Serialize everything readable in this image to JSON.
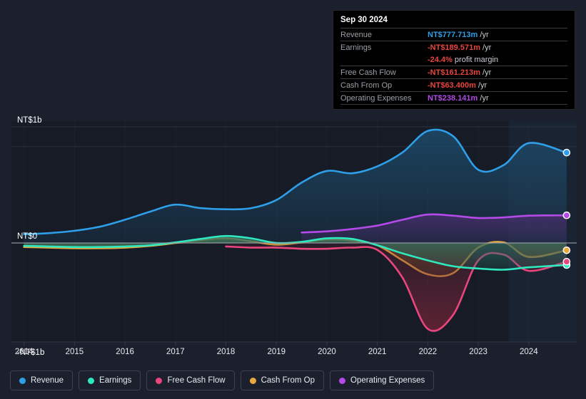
{
  "theme": {
    "background": "#1b202c",
    "plot_background": "#161b26",
    "gridline": "#3a4050",
    "zeroline": "#9aa0a6",
    "forecast_band": "#1f2a3a"
  },
  "tooltip": {
    "date": "Sep 30 2024",
    "rows": [
      {
        "key": "Revenue",
        "amount": "NT$777.713m",
        "unit": "/yr",
        "color": "#2e9fe8"
      },
      {
        "key": "Earnings",
        "amount": "-NT$189.571m",
        "unit": "/yr",
        "color": "#e8453f"
      },
      {
        "key": "",
        "amount": "-24.4%",
        "unit": "profit margin",
        "color": "#e8453f"
      },
      {
        "key": "Free Cash Flow",
        "amount": "-NT$161.213m",
        "unit": "/yr",
        "color": "#e8453f"
      },
      {
        "key": "Cash From Op",
        "amount": "-NT$63.400m",
        "unit": "/yr",
        "color": "#e8453f"
      },
      {
        "key": "Operating Expenses",
        "amount": "NT$238.141m",
        "unit": "/yr",
        "color": "#b44ae8"
      }
    ]
  },
  "legend": {
    "items": [
      {
        "label": "Revenue",
        "color": "#2e9fe8"
      },
      {
        "label": "Earnings",
        "color": "#2ee8c0"
      },
      {
        "label": "Free Cash Flow",
        "color": "#e8467c"
      },
      {
        "label": "Cash From Op",
        "color": "#e8a93f"
      },
      {
        "label": "Operating Expenses",
        "color": "#b44ae8"
      }
    ]
  },
  "chart_data": {
    "type": "area",
    "title": "",
    "xlabel": "",
    "ylabel": "",
    "grid": true,
    "legend_position": "bottom",
    "currency": "NT$",
    "unit": "billions",
    "ylim": [
      -1.15,
      1.1
    ],
    "yticks": [
      {
        "value": 1,
        "label": "NT$1b"
      },
      {
        "value": 0,
        "label": "NT$0"
      },
      {
        "value": -1,
        "label": "-NT$1b"
      }
    ],
    "gridlines": [
      1,
      0.83,
      0,
      -1
    ],
    "xlim": [
      2013.75,
      2024.95
    ],
    "xticks": [
      2014,
      2015,
      2016,
      2017,
      2018,
      2019,
      2020,
      2021,
      2022,
      2023,
      2024
    ],
    "xtick_labels": [
      "2014",
      "2015",
      "2016",
      "2017",
      "2018",
      "2019",
      "2020",
      "2021",
      "2022",
      "2023",
      "2024"
    ],
    "forecast_start": 2023.6,
    "x": [
      2014,
      2014.5,
      2015,
      2015.5,
      2016,
      2016.5,
      2017,
      2017.5,
      2018,
      2018.5,
      2019,
      2019.5,
      2020,
      2020.5,
      2021,
      2021.5,
      2022,
      2022.5,
      2023,
      2023.5,
      2024,
      2024.75
    ],
    "series": [
      {
        "name": "Revenue",
        "color": "#2e9fe8",
        "fill": "#1d4d6e",
        "values": [
          0.075,
          0.085,
          0.105,
          0.14,
          0.2,
          0.27,
          0.33,
          0.3,
          0.29,
          0.3,
          0.37,
          0.52,
          0.62,
          0.6,
          0.66,
          0.78,
          0.965,
          0.92,
          0.63,
          0.67,
          0.86,
          0.778
        ],
        "endpoint": {
          "x": 2024.75,
          "y": 0.778
        }
      },
      {
        "name": "Earnings",
        "color": "#2ee8c0",
        "fill": "#2a6e63",
        "values": [
          -0.025,
          -0.03,
          -0.035,
          -0.035,
          -0.03,
          -0.02,
          0.005,
          0.035,
          0.06,
          0.04,
          0.0,
          0.01,
          0.04,
          0.035,
          -0.02,
          -0.09,
          -0.15,
          -0.2,
          -0.22,
          -0.23,
          -0.21,
          -0.19
        ],
        "endpoint": {
          "x": 2024.75,
          "y": -0.19
        }
      },
      {
        "name": "Free Cash Flow",
        "color": "#e8467c",
        "fill": "#6e2436",
        "values": [
          null,
          null,
          null,
          null,
          null,
          null,
          null,
          null,
          -0.03,
          -0.04,
          -0.04,
          -0.05,
          -0.05,
          -0.04,
          -0.06,
          -0.3,
          -0.74,
          -0.62,
          -0.15,
          -0.1,
          -0.24,
          -0.161
        ],
        "endpoint": {
          "x": 2024.75,
          "y": -0.161
        }
      },
      {
        "name": "Cash From Op",
        "color": "#e8a93f",
        "fill": "#6e5322",
        "values": [
          -0.035,
          -0.04,
          -0.045,
          -0.045,
          -0.04,
          -0.025,
          0.0,
          0.025,
          0.04,
          0.015,
          -0.015,
          0.005,
          0.03,
          0.02,
          -0.02,
          -0.15,
          -0.27,
          -0.26,
          -0.04,
          0.005,
          -0.12,
          -0.063
        ],
        "endpoint": {
          "x": 2024.75,
          "y": -0.063
        }
      },
      {
        "name": "Operating Expenses",
        "color": "#b44ae8",
        "fill": "#4a2d6e",
        "values": [
          null,
          null,
          null,
          null,
          null,
          null,
          null,
          null,
          null,
          null,
          null,
          0.09,
          0.1,
          0.12,
          0.15,
          0.2,
          0.245,
          0.235,
          0.215,
          0.22,
          0.235,
          0.238
        ],
        "endpoint": {
          "x": 2024.75,
          "y": 0.238
        }
      }
    ]
  }
}
